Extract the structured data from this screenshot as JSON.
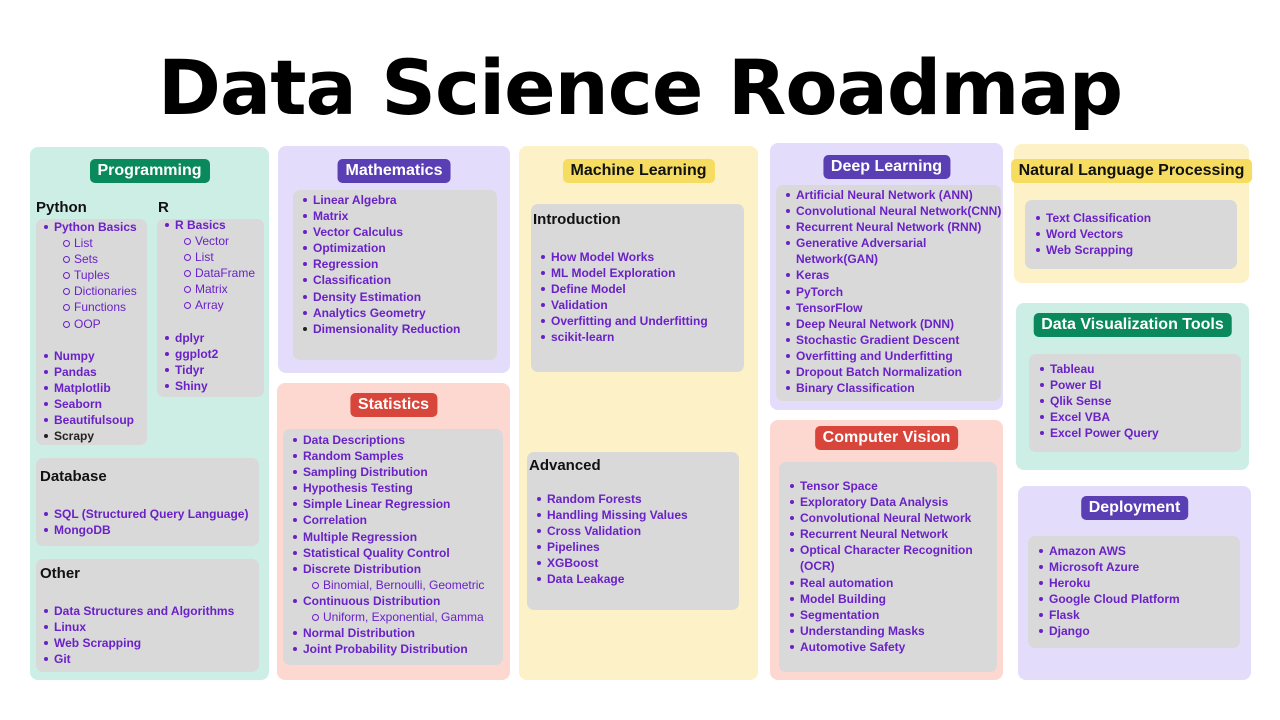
{
  "title": "Data Science Roadmap",
  "programming": {
    "header": "Programming",
    "python": {
      "heading": "Python",
      "items": [
        "Python Basics",
        "List",
        "Sets",
        "Tuples",
        "Dictionaries",
        "Functions",
        "OOP",
        "Numpy",
        "Pandas",
        "Matplotlib",
        "Seaborn",
        "Beautifulsoup",
        "Scrapy"
      ]
    },
    "r": {
      "heading": "R",
      "items": [
        "R Basics",
        "Vector",
        "List",
        "DataFrame",
        "Matrix",
        "Array",
        "dplyr",
        "ggplot2",
        "Tidyr",
        "Shiny"
      ]
    },
    "database": {
      "heading": "Database",
      "items": [
        "SQL (Structured Query Language)",
        "MongoDB"
      ]
    },
    "other": {
      "heading": "Other",
      "items": [
        "Data Structures and Algorithms",
        "Linux",
        "Web Scrapping",
        "Git"
      ]
    }
  },
  "mathematics": {
    "header": "Mathematics",
    "items": [
      "Linear Algebra",
      "Matrix",
      "Vector Calculus",
      "Optimization",
      "Regression",
      "Classification",
      "Density Estimation",
      "Analytics Geometry",
      "Dimensionality Reduction"
    ]
  },
  "statistics": {
    "header": "Statistics",
    "items": [
      "Data Descriptions",
      "Random Samples",
      "Sampling Distribution",
      "Hypothesis Testing",
      "Simple Linear Regression",
      "Correlation",
      "Multiple Regression",
      "Statistical Quality Control",
      "Discrete Distribution",
      "Binomial, Bernoulli, Geometric",
      "Continuous Distribution",
      "Uniform, Exponential, Gamma",
      "Normal Distribution",
      "Joint Probability Distribution"
    ]
  },
  "machine_learning": {
    "header": "Machine Learning",
    "introduction": {
      "heading": "Introduction",
      "items": [
        "How Model Works",
        "ML Model Exploration",
        "Define Model",
        "Validation",
        "Overfitting and Underfitting",
        "scikit-learn"
      ]
    },
    "advanced": {
      "heading": "Advanced",
      "items": [
        "Random Forests",
        "Handling Missing Values",
        "Cross Validation",
        "Pipelines",
        "XGBoost",
        "Data Leakage"
      ]
    }
  },
  "deep_learning": {
    "header": "Deep Learning",
    "items": [
      "Artificial Neural Network (ANN)",
      "Convolutional Neural Network(CNN)",
      "Recurrent Neural Network (RNN)",
      "Generative Adversarial",
      "Network(GAN)",
      "Keras",
      "PyTorch",
      "TensorFlow",
      "Deep Neural Network (DNN)",
      "Stochastic Gradient Descent",
      "Overfitting and Underfitting",
      "Dropout Batch Normalization",
      "Binary Classification"
    ]
  },
  "computer_vision": {
    "header": "Computer Vision",
    "items": [
      "Tensor Space",
      "Exploratory Data Analysis",
      "Convolutional Neural Network",
      "Recurrent Neural Network",
      "Optical Character Recognition",
      "(OCR)",
      "Real automation",
      "Model Building",
      "Segmentation",
      "Understanding Masks",
      "Automotive Safety"
    ]
  },
  "nlp": {
    "header": "Natural Language Processing",
    "items": [
      "Text Classification",
      "Word Vectors",
      "Web Scrapping"
    ]
  },
  "data_visualization": {
    "header": "Data Visualization Tools",
    "items": [
      "Tableau",
      "Power BI",
      "Qlik Sense",
      "Excel VBA",
      "Excel Power Query"
    ]
  },
  "deployment": {
    "header": "Deployment",
    "items": [
      "Amazon AWS",
      "Microsoft Azure",
      "Heroku",
      "Google Cloud Platform",
      "Flask",
      "Django"
    ]
  },
  "colors": {
    "accent_text": "#6b21c8",
    "programming_panel": "#cdeee4",
    "math_panel": "#e4dcfb",
    "stats_panel": "#fdd8d1",
    "ml_panel": "#fdf1c8",
    "item_box": "#d9d9d9"
  }
}
